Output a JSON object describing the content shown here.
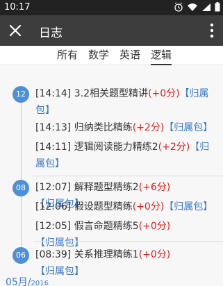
{
  "status_bar": {
    "time": "10:17",
    "icons": [
      "alarm-icon",
      "wifi-icon",
      "signal-icon",
      "battery-icon"
    ]
  },
  "app_bar": {
    "title": "日志",
    "close_icon": "close-icon",
    "menu_icon": "more-vert-icon"
  },
  "tabs": [
    {
      "label": "所有",
      "active": false
    },
    {
      "label": "数学",
      "active": false
    },
    {
      "label": "英语",
      "active": false
    },
    {
      "label": "逻辑",
      "active": true
    }
  ],
  "days": [
    {
      "day": "12",
      "entries": [
        {
          "time": "[14:14]",
          "name": "3.2相关题型精讲",
          "score": "(+0分)",
          "link": "【归属包】"
        },
        {
          "time": "[14:13]",
          "name": "归纳类比精练",
          "score": "(+2分)",
          "link": "【归属包】"
        },
        {
          "time": "[14:11]",
          "name": "逻辑阅读能力精练2",
          "score": "(+2分)",
          "link": "【归属包】"
        }
      ]
    },
    {
      "day": "08",
      "entries": [
        {
          "time": "[12:07]",
          "name": "解释题型精练2",
          "score": "(+6分)",
          "link": "【归属包】"
        },
        {
          "time": "[12:06]",
          "name": "假设题型精练",
          "score": "(+0分)",
          "link": "【归属包】"
        },
        {
          "time": "[12:05]",
          "name": "假言命题精练5",
          "score": "(+0分)",
          "link": "【归属包】"
        }
      ]
    },
    {
      "day": "06",
      "entries": [
        {
          "time": "[08:39]",
          "name": "关系推理精练1",
          "score": "(+0分)",
          "link": "【归属包】"
        }
      ]
    }
  ],
  "month_header": {
    "month": "05月/",
    "year": "2016"
  },
  "colors": {
    "accent": "#4f8fd6",
    "score": "#e01b1b",
    "link": "#3e7bc4",
    "app_bar": "#3d3d3d"
  }
}
